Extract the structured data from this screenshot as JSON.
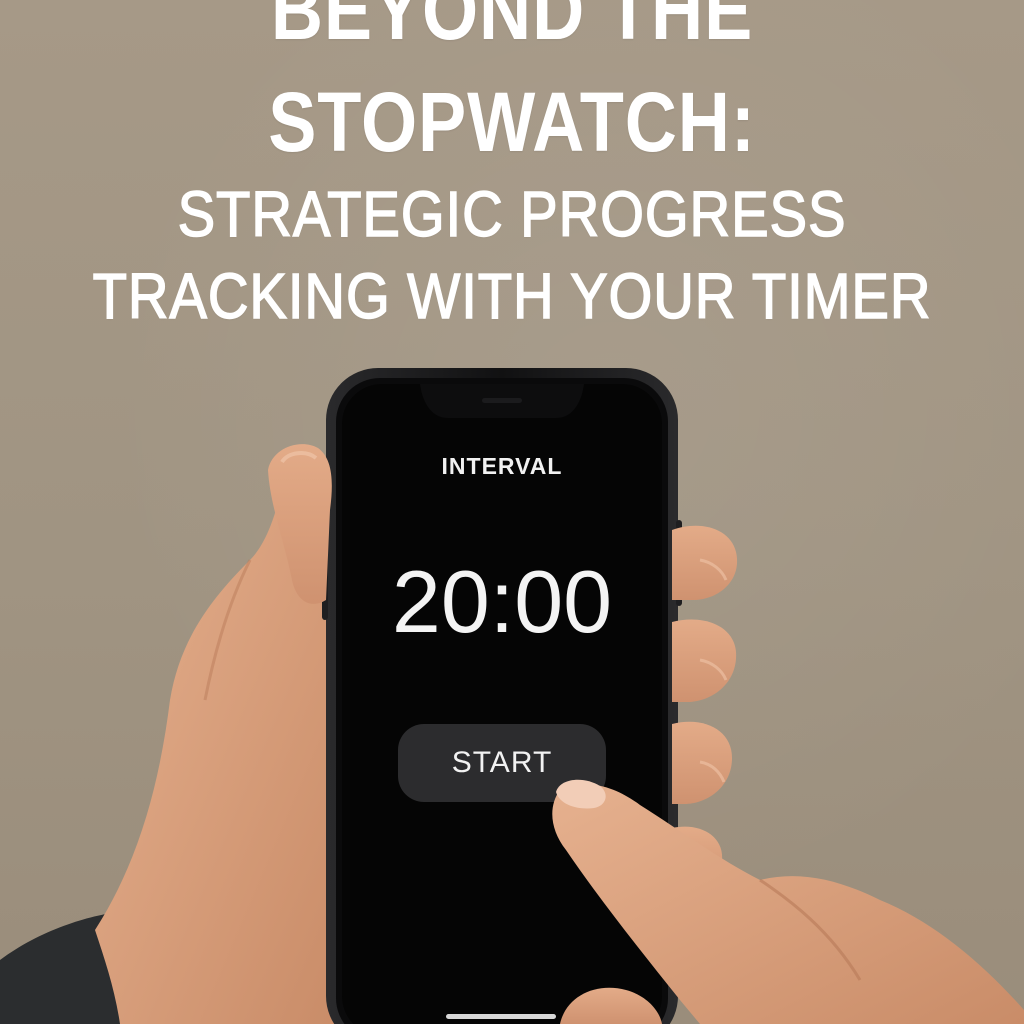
{
  "headline": {
    "line1": "BEYOND THE",
    "line2": "STOPWATCH:",
    "line3": "STRATEGIC PROGRESS",
    "line4": "TRACKING WITH YOUR TIMER"
  },
  "timer_app": {
    "mode_label": "INTERVAL",
    "time_display": "20:00",
    "start_button_label": "START"
  },
  "colors": {
    "background": "#a29684",
    "headline_text": "#ffffff",
    "phone_body": "#161617",
    "screen": "#050505",
    "button": "#2c2c2e",
    "skin": "#dba07e"
  },
  "icons": {
    "device": "smartphone",
    "hand": "hand"
  }
}
